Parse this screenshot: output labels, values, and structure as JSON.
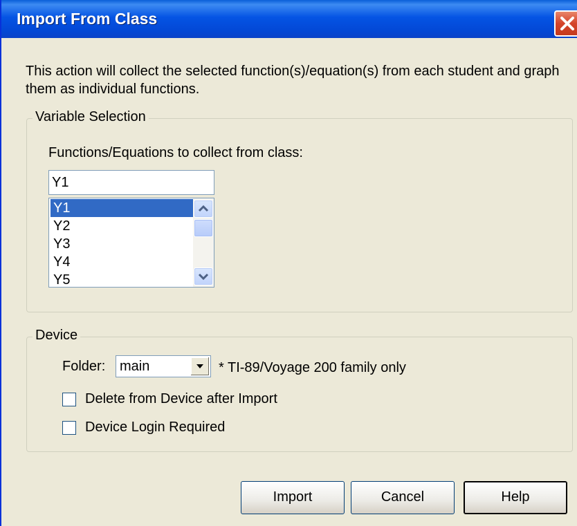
{
  "window": {
    "title": "Import From Class",
    "close_icon": "close-icon"
  },
  "description": "This action will collect the selected function(s)/equation(s) from each student and graph them as individual functions.",
  "variable_selection": {
    "group_label": "Variable Selection",
    "prompt": "Functions/Equations to collect from class:",
    "input_value": "Y1",
    "list_items": [
      "Y1",
      "Y2",
      "Y3",
      "Y4",
      "Y5"
    ],
    "selected_item": "Y1"
  },
  "device": {
    "group_label": "Device",
    "folder_label": "Folder:",
    "folder_value": "main",
    "folder_note": "* TI-89/Voyage 200 family only",
    "delete_label": "Delete from Device after Import",
    "login_label": "Device Login Required",
    "delete_checked": false,
    "login_checked": false
  },
  "buttons": {
    "import": "Import",
    "cancel": "Cancel",
    "help": "Help"
  },
  "colors": {
    "title_bar": "#0554e4",
    "dialog_bg": "#ece9d8",
    "selection": "#316ac5",
    "close_button": "#d4432a"
  }
}
